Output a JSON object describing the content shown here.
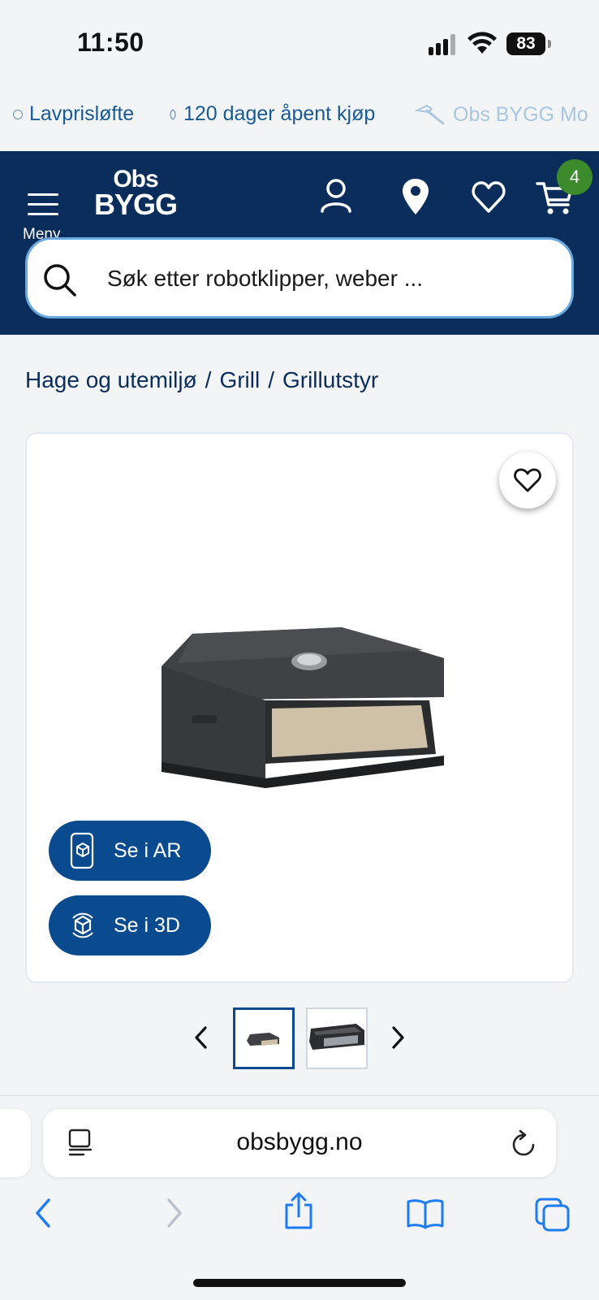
{
  "status_bar": {
    "time": "11:50",
    "battery": "83"
  },
  "promo": {
    "items": [
      {
        "label": "Lavprisløfte"
      },
      {
        "label": "120 dager åpent kjøp"
      },
      {
        "label": "Obs BYGG Mo"
      }
    ]
  },
  "header": {
    "menu_label": "Meny",
    "logo_line1": "Obs",
    "logo_line2": "BYGG",
    "cart_count": "4"
  },
  "search": {
    "placeholder": "Søk etter robotklipper, weber ..."
  },
  "breadcrumb": [
    "Hage og utemiljø",
    "Grill",
    "Grillutstyr"
  ],
  "product": {
    "ar_label": "Se i AR",
    "view3d_label": "Se i 3D"
  },
  "browser": {
    "url": "obsbygg.no"
  },
  "colors": {
    "brand_navy": "#0a2d5b",
    "button_blue": "#0a4a8e",
    "badge_green": "#3b8a2c",
    "search_border": "#6aa9e0"
  }
}
